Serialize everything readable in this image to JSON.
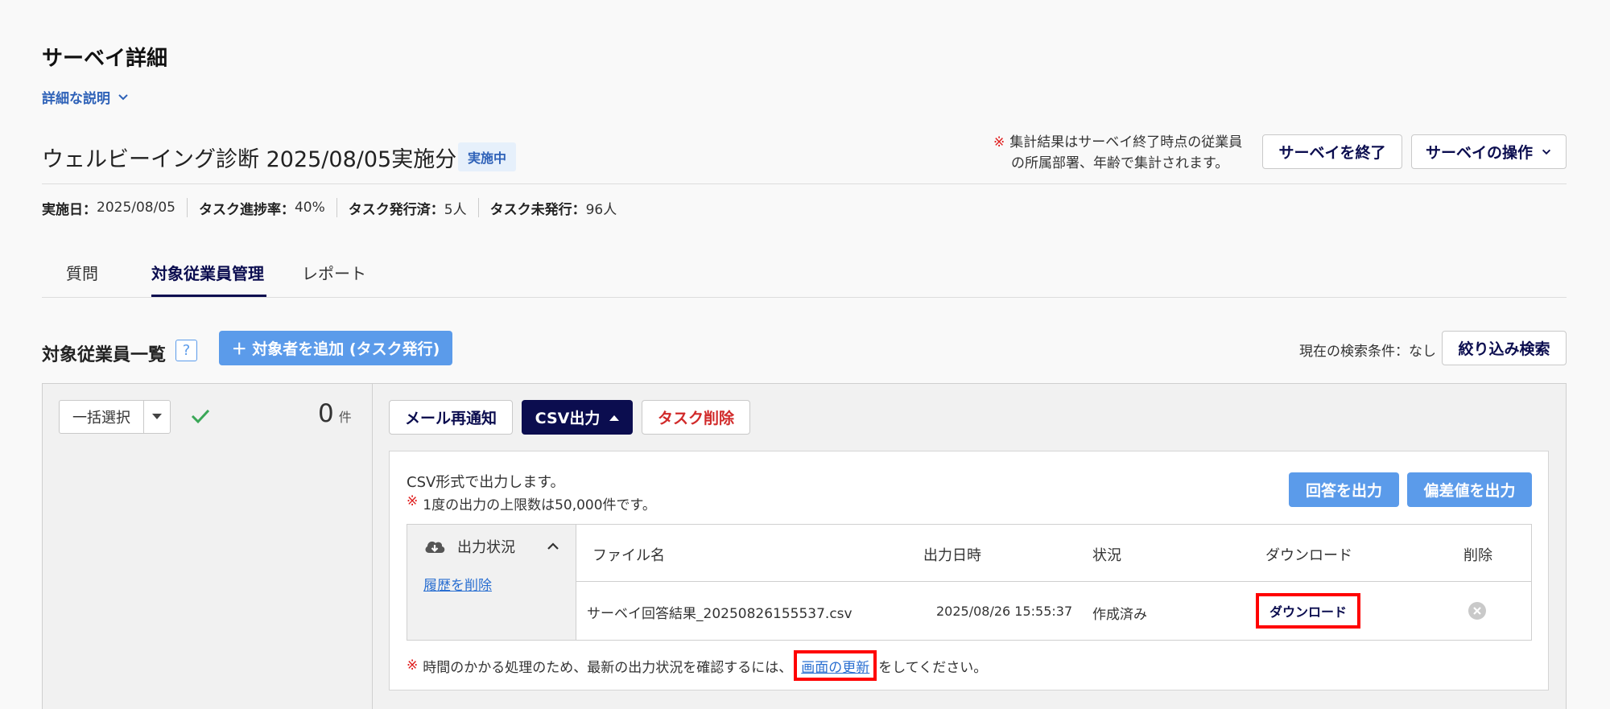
{
  "header": {
    "page_title": "サーベイ詳細",
    "detail_link": "詳細な説明",
    "survey_name": "ウェルビーイング診断 2025/08/05実施分",
    "status_badge": "実施中",
    "notice_mark": "※",
    "notice_line1": "集計結果はサーベイ終了時点の従業員",
    "notice_line2": "の所属部署、年齢で集計されます。",
    "end_survey_button": "サーベイを終了",
    "operations_button": "サーベイの操作"
  },
  "meta": {
    "date_label": "実施日：",
    "date_value": "2025/08/05",
    "progress_label": "タスク進捗率：",
    "progress_value": "40%",
    "issued_label": "タスク発行済：",
    "issued_value": "5人",
    "unissued_label": "タスク未発行：",
    "unissued_value": "96人"
  },
  "tabs": [
    {
      "label": "質問",
      "active": false
    },
    {
      "label": "対象従業員管理",
      "active": true
    },
    {
      "label": "レポート",
      "active": false
    }
  ],
  "list": {
    "title": "対象従業員一覧",
    "help": "?",
    "add_button": "＋ 対象者を追加 (タスク発行)",
    "search_condition": "現在の検索条件：なし",
    "filter_button": "絞り込み検索"
  },
  "selection": {
    "bulk_select": "一括選択",
    "count": "0",
    "count_unit": "件"
  },
  "actions": {
    "resend_mail": "メール再通知",
    "csv_export": "CSV出力",
    "delete_task": "タスク削除"
  },
  "csv_panel": {
    "description": "CSV形式で出力します。",
    "limit_mark": "※",
    "limit_note": "1度の出力の上限数は50,000件です。",
    "export_answers": "回答を出力",
    "export_deviation": "偏差値を出力",
    "status_title": "出力状況",
    "clear_history": "履歴を削除",
    "columns": {
      "filename": "ファイル名",
      "datetime": "出力日時",
      "status": "状況",
      "download": "ダウンロード",
      "delete": "削除"
    },
    "rows": [
      {
        "filename": "サーベイ回答結果_20250826155537.csv",
        "datetime": "2025/08/26 15:55:37",
        "status": "作成済み",
        "download": "ダウンロード"
      }
    ],
    "footer_mark": "※",
    "footer_pre": "時間のかかる処理のため、最新の出力状況を確認するには、",
    "footer_link": "画面の更新",
    "footer_post": "をしてください。"
  },
  "colors": {
    "navy": "#0b0d4f",
    "accent_blue": "#5b9bea",
    "alert_red": "#e02020",
    "check_green": "#3aa757"
  }
}
